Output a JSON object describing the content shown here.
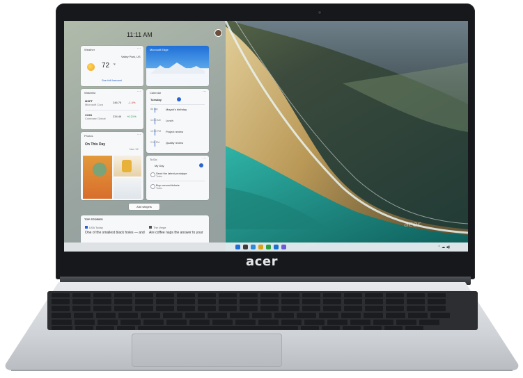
{
  "device": {
    "brand": "acer",
    "wallpaper_brand": "acer"
  },
  "desktop": {
    "clock": "11:11 AM",
    "taskbar": {
      "date_line1": "",
      "date_line2": "",
      "icon_colors": [
        "#1f6fd8",
        "#3c3c3c",
        "#2d8ad6",
        "#d9a21b",
        "#2ea043",
        "#1b73d0",
        "#6e5bd6"
      ]
    },
    "widgets": {
      "add_widgets_label": "Add widgets",
      "weather": {
        "title": "Weather",
        "temp": "72",
        "unit": "°F",
        "location": "Valley Park, US",
        "forecast_link": "See full forecast"
      },
      "photo_top": {
        "title": "Microsoft Edge"
      },
      "watchlist": {
        "title": "Watchlist",
        "rows": [
          {
            "symbol": "MSFT",
            "name": "Microsoft Corp",
            "price": "246.75",
            "change": "-1.4%"
          },
          {
            "symbol": "COIN",
            "name": "Coinbase Global",
            "price": "234.46",
            "change": "+0.21%"
          }
        ]
      },
      "calendar": {
        "title": "Calendar",
        "today": "Tuesday",
        "events": [
          {
            "time": "All day",
            "label": "Mayah's birthday"
          },
          {
            "time": "11:00 AM",
            "label": "Lunch"
          },
          {
            "time": "12:30 PM",
            "label": "Project review"
          },
          {
            "time": "2:00 PM",
            "label": "Quality review"
          }
        ]
      },
      "photos": {
        "title": "Photos",
        "subtitle": "On This Day",
        "date": "Nov 12"
      },
      "todo": {
        "title": "To Do",
        "list_name": "My Day",
        "items": [
          {
            "label": "Send the latest prototype",
            "sub": "Tasks"
          },
          {
            "label": "Buy concert tickets",
            "sub": "Tasks"
          }
        ]
      },
      "news": {
        "header": "TOP STORIES",
        "stories": [
          {
            "source": "USA Today",
            "headline": "One of the smallest black holes — and"
          },
          {
            "source": "The Verge",
            "headline": "Are coffee naps the answer to your"
          }
        ]
      }
    }
  },
  "colors": {
    "lid": "#17181b",
    "deck": "#d5d8dc",
    "keys": "#1b1c1f"
  }
}
